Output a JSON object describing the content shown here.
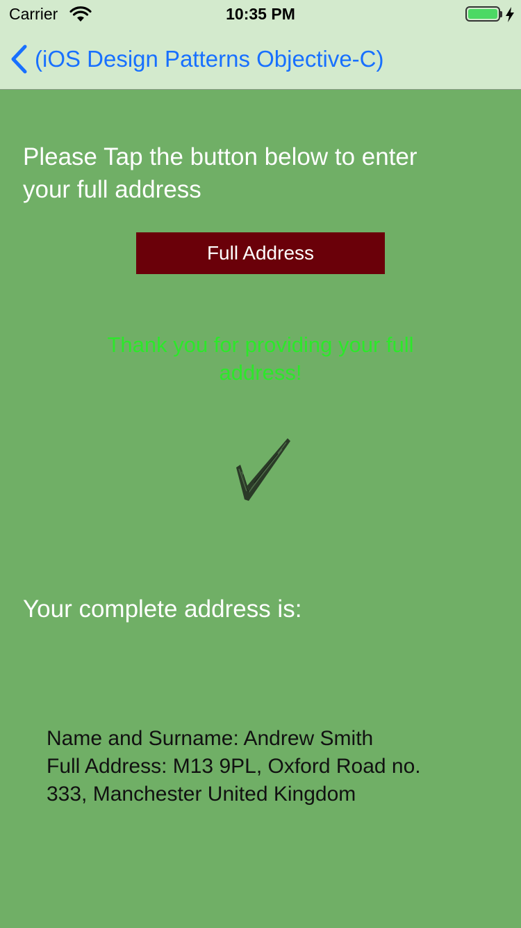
{
  "status_bar": {
    "carrier": "Carrier",
    "time": "10:35 PM",
    "battery_level": 1.0,
    "battery_color": "#4cd964"
  },
  "nav": {
    "back_label": "(iOS Design Patterns Objective-C)",
    "back_icon": "chevron-left-icon",
    "tint": "#1870ff"
  },
  "main": {
    "prompt": "Please Tap the button below to enter your full address",
    "button_label": "Full Address",
    "button_color": "#6a0009",
    "thanks_message": "Thank you for providing your full address!",
    "thanks_color": "#2ce82a",
    "status_icon": "checkmark-icon",
    "complete_label": "Your complete address is:",
    "address_lines": [
      "Name and Surname: Andrew Smith",
      "Full Address: M13 9PL, Oxford Road no.",
      "333, Manchester United Kingdom"
    ]
  },
  "colors": {
    "background": "#70af66",
    "navbar": "#d3eacd"
  }
}
